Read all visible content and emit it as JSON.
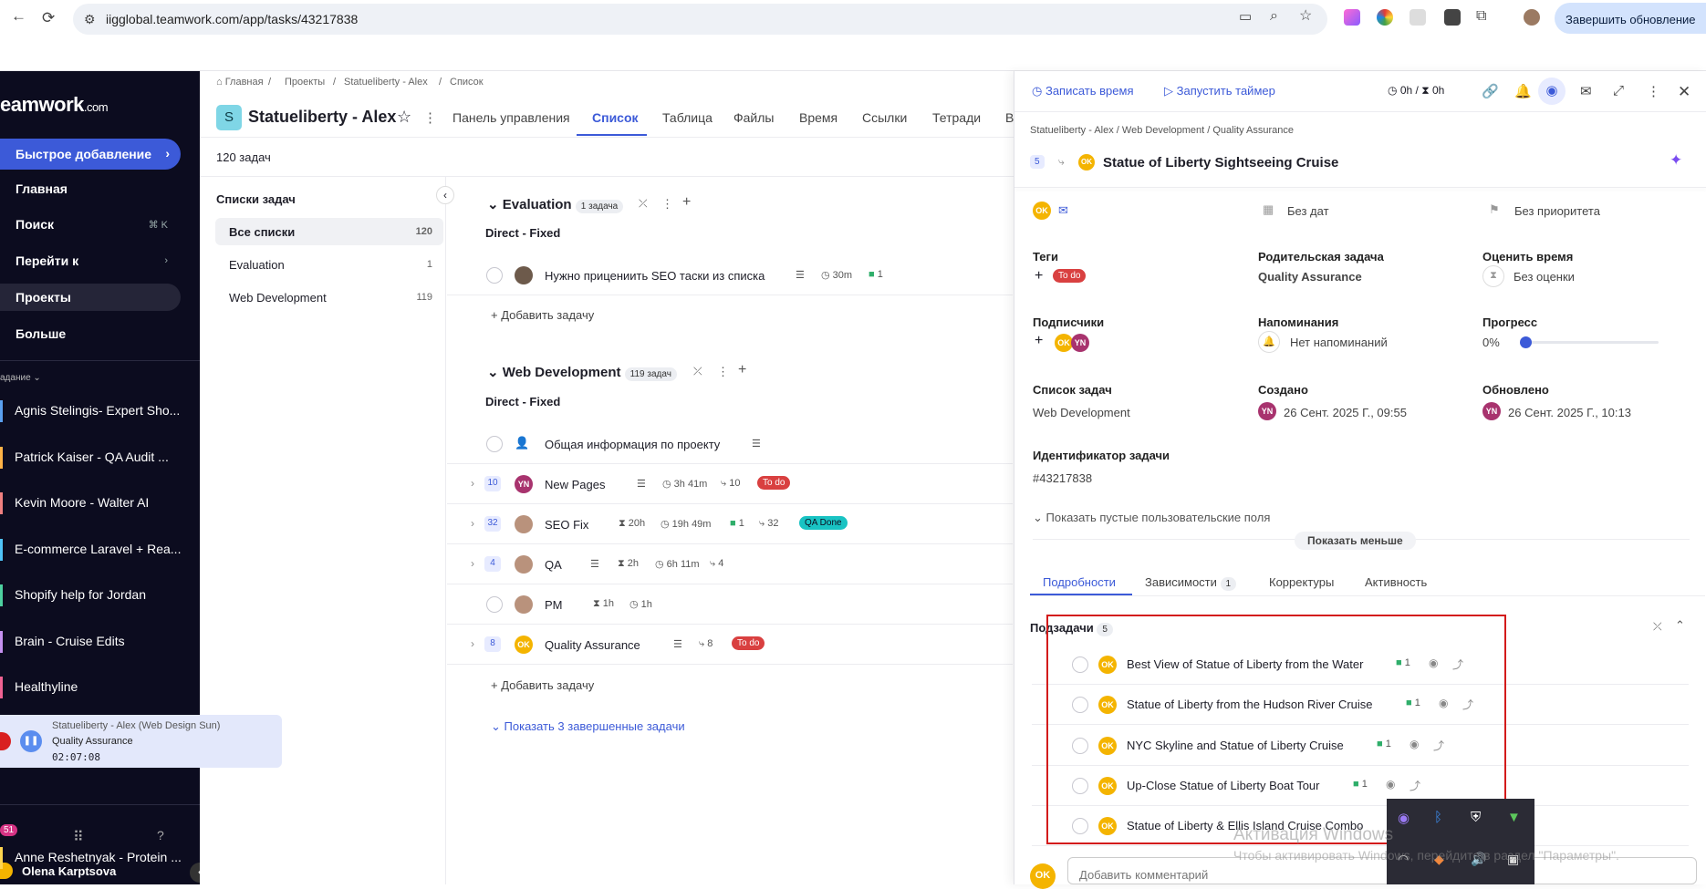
{
  "browser": {
    "url": "iigglobal.teamwork.com/app/tasks/43217838",
    "update_button": "Завершить обновление"
  },
  "sidebar": {
    "logo": "eamwork",
    "logo_suffix": ".com",
    "quick_add": "Быстрое добавление",
    "nav": [
      {
        "label": "Главная"
      },
      {
        "label": "Поиск",
        "shortcut": "⌘ K"
      },
      {
        "label": "Перейти к"
      },
      {
        "label": "Проекты"
      },
      {
        "label": "Больше"
      }
    ],
    "section_label": "адание",
    "favorites": [
      {
        "label": "Agnis Stelingis- Expert Sho...",
        "color": "#5aa0f0"
      },
      {
        "label": "Patrick Kaiser - QA Audit ...",
        "color": "#ffb347"
      },
      {
        "label": "Kevin Moore - Walter AI",
        "color": "#f08080"
      },
      {
        "label": "E-commerce Laravel + Rea...",
        "color": "#4fc3f7"
      },
      {
        "label": "Shopify help for Jordan",
        "color": "#4dd0a0"
      },
      {
        "label": "Brain - Cruise Edits",
        "color": "#c591f0"
      },
      {
        "label": "Healthyline",
        "color": "#f06292"
      },
      {
        "label": "Anne Reshetnyak - Protein ...",
        "color": "#ffd54f"
      }
    ],
    "timer": {
      "project": "Statueliberty - Alex (Web Design Sun)",
      "task": "Quality Assurance",
      "time": "02:07:08"
    },
    "notif_count": "51",
    "user_name": "Olena Karptsova"
  },
  "project": {
    "breadcrumb": [
      "Главная",
      "Проекты",
      "Statueliberty - Alex",
      "Список"
    ],
    "avatar_letter": "S",
    "title": "Statueliberty - Alex",
    "tabs": [
      "Панель управления",
      "Список",
      "Таблица",
      "Файлы",
      "Время",
      "Ссылки",
      "Тетради",
      "В"
    ],
    "task_count": "120 задач",
    "lists_title": "Списки задач",
    "lists": [
      {
        "label": "Все списки",
        "count": "120"
      },
      {
        "label": "Evaluation",
        "count": "1"
      },
      {
        "label": "Web Development",
        "count": "119"
      }
    ]
  },
  "groups": {
    "evaluation": {
      "title": "Evaluation",
      "count": "1 задача",
      "sub": "Direct - Fixed",
      "task": {
        "name": "Нужно прицениить SEO таски из списка",
        "time": "30m",
        "comments": "1"
      },
      "add": "Добавить задачу"
    },
    "webdev": {
      "title": "Web Development",
      "count": "119 задач",
      "sub": "Direct - Fixed",
      "tasks": [
        {
          "name": "Общая информация по проекту"
        },
        {
          "num": "10",
          "name": "New Pages",
          "logged": "3h 41m",
          "subs": "10",
          "badge": "To do"
        },
        {
          "num": "32",
          "name": "SEO Fix",
          "est": "20h",
          "logged": "19h 49m",
          "comments": "1",
          "subs": "32",
          "badge": "QA Done"
        },
        {
          "num": "4",
          "name": "QA",
          "est": "2h",
          "logged": "6h 11m",
          "subs": "4"
        },
        {
          "name": "PM",
          "est": "1h",
          "logged": "1h"
        },
        {
          "num": "8",
          "name": "Quality Assurance",
          "subs": "8",
          "badge": "To do"
        }
      ],
      "add": "Добавить задачу",
      "show_completed": "Показать 3 завершенные задачи"
    }
  },
  "panel": {
    "log_time": "Записать время",
    "start_timer": "Запустить таймер",
    "time_logged": "0h",
    "time_sep": "/",
    "time_est": "0h",
    "breadcrumb": [
      "Statueliberty - Alex",
      "Web Development",
      "Quality Assurance"
    ],
    "sub_count": "5",
    "title": "Statue of Liberty Sightseeing Cruise",
    "no_dates": "Без дат",
    "no_priority": "Без приоритета",
    "tags_label": "Теги",
    "tag": "To do",
    "parent_label": "Родительская задача",
    "parent_value": "Quality Assurance",
    "estimate_label": "Оценить время",
    "estimate_value": "Без оценки",
    "followers_label": "Подписчики",
    "reminders_label": "Напоминания",
    "reminders_value": "Нет напоминаний",
    "progress_label": "Прогресс",
    "progress_value": "0%",
    "progress_fraction": 0,
    "tasklist_label": "Список задач",
    "tasklist_value": "Web Development",
    "created_label": "Создано",
    "created_value": "26 Сент. 2025 Г., 09:55",
    "updated_label": "Обновлено",
    "updated_value": "26 Сент. 2025 Г., 10:13",
    "id_label": "Идентификатор задачи",
    "id_value": "#43217838",
    "show_empty": "Показать пустые пользовательские поля",
    "show_less": "Показать меньше",
    "tabs": [
      {
        "label": "Подробности"
      },
      {
        "label": "Зависимости",
        "count": "1"
      },
      {
        "label": "Корректуры"
      },
      {
        "label": "Активность"
      }
    ],
    "subtasks_label": "Подзадачи",
    "subtasks_count": "5",
    "subtasks": [
      {
        "title": "Best View of Statue of Liberty from the Water",
        "comments": "1"
      },
      {
        "title": "Statue of Liberty from the Hudson River Cruise",
        "comments": "1"
      },
      {
        "title": "NYC Skyline and Statue of Liberty Cruise",
        "comments": "1"
      },
      {
        "title": "Up-Close Statue of Liberty Boat Tour",
        "comments": "1"
      },
      {
        "title": "Statue of Liberty & Ellis Island Cruise Combo",
        "comments": ""
      }
    ],
    "comment_placeholder": "Добавить комментарий",
    "avatar_ok": "OK",
    "avatar_yn": "YN"
  },
  "watermark": {
    "line1": "Активация Windows",
    "line2": "Чтобы активировать Windows, перейдите в раздел \"Параметры\"."
  },
  "colors": {
    "accent": "#3c5ad8",
    "sidebar": "#0c0c1f",
    "danger": "#d94040",
    "highlight": "#d31b1b"
  }
}
